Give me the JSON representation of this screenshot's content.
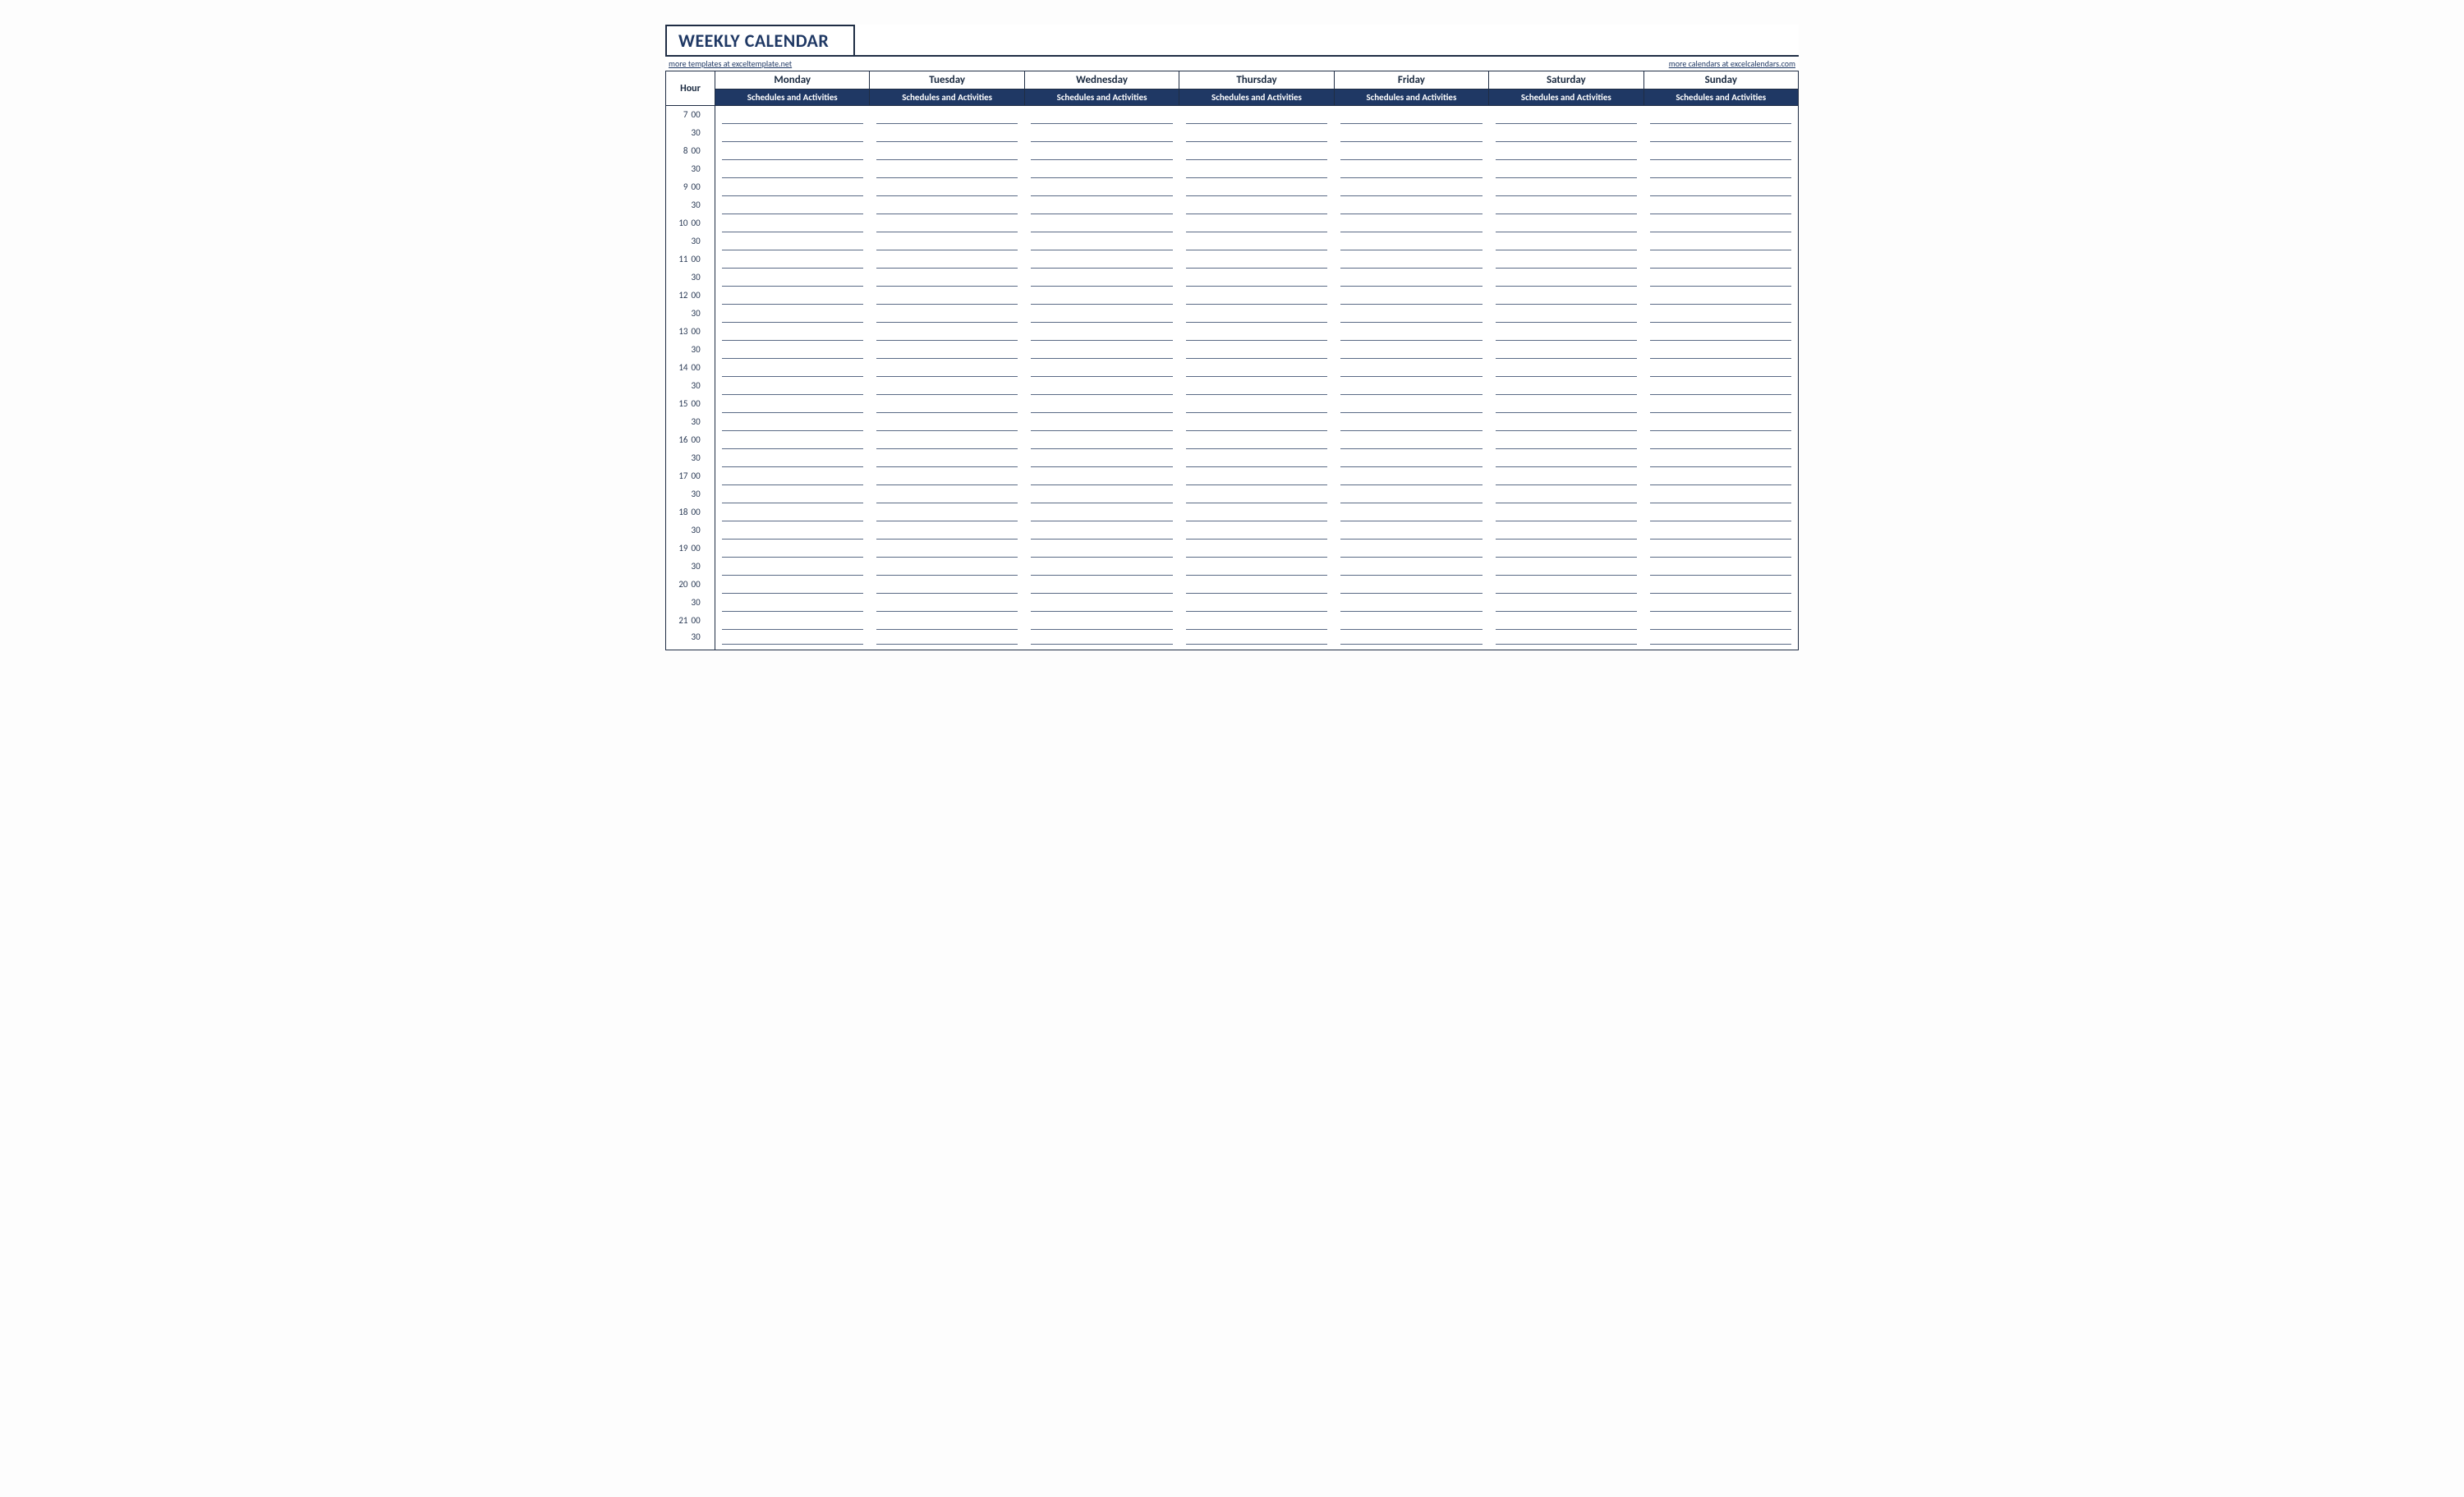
{
  "title": "WEEKLY CALENDAR",
  "links": {
    "left_text": "more templates at exceltemplate.net",
    "right_text": "more calendars at excelcalendars.com"
  },
  "hour_column_header": "Hour",
  "sub_header_label": "Schedules and Activities",
  "days": [
    "Monday",
    "Tuesday",
    "Wednesday",
    "Thursday",
    "Friday",
    "Saturday",
    "Sunday"
  ],
  "time_slots": [
    {
      "hour": "7",
      "min": "00"
    },
    {
      "hour": "",
      "min": "30"
    },
    {
      "hour": "8",
      "min": "00"
    },
    {
      "hour": "",
      "min": "30"
    },
    {
      "hour": "9",
      "min": "00"
    },
    {
      "hour": "",
      "min": "30"
    },
    {
      "hour": "10",
      "min": "00"
    },
    {
      "hour": "",
      "min": "30"
    },
    {
      "hour": "11",
      "min": "00"
    },
    {
      "hour": "",
      "min": "30"
    },
    {
      "hour": "12",
      "min": "00"
    },
    {
      "hour": "",
      "min": "30"
    },
    {
      "hour": "13",
      "min": "00"
    },
    {
      "hour": "",
      "min": "30"
    },
    {
      "hour": "14",
      "min": "00"
    },
    {
      "hour": "",
      "min": "30"
    },
    {
      "hour": "15",
      "min": "00"
    },
    {
      "hour": "",
      "min": "30"
    },
    {
      "hour": "16",
      "min": "00"
    },
    {
      "hour": "",
      "min": "30"
    },
    {
      "hour": "17",
      "min": "00"
    },
    {
      "hour": "",
      "min": "30"
    },
    {
      "hour": "18",
      "min": "00"
    },
    {
      "hour": "",
      "min": "30"
    },
    {
      "hour": "19",
      "min": "00"
    },
    {
      "hour": "",
      "min": "30"
    },
    {
      "hour": "20",
      "min": "00"
    },
    {
      "hour": "",
      "min": "30"
    },
    {
      "hour": "21",
      "min": "00"
    },
    {
      "hour": "",
      "min": "30"
    }
  ]
}
